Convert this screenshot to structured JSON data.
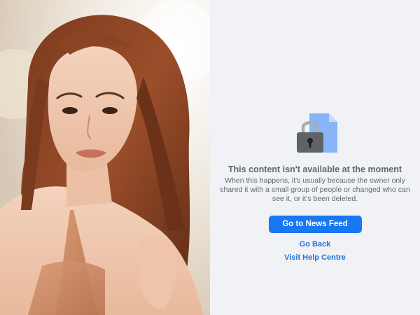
{
  "message": {
    "title": "This content isn't available at the moment",
    "body": "When this happens, it's usually because the owner only shared it with a small group of people or changed who can see it, or it's been deleted."
  },
  "actions": {
    "primary_label": "Go to News Feed",
    "go_back_label": "Go Back",
    "help_label": "Visit Help Centre"
  },
  "icons": {
    "lock": "padlock-icon",
    "document": "document-icon"
  },
  "colors": {
    "panel_background": "#f0f2f5",
    "primary_button": "#1877f2",
    "link": "#216fdb",
    "text_secondary": "#606770",
    "document_blue": "#8ab4f8",
    "lock_body": "#5f6368"
  }
}
